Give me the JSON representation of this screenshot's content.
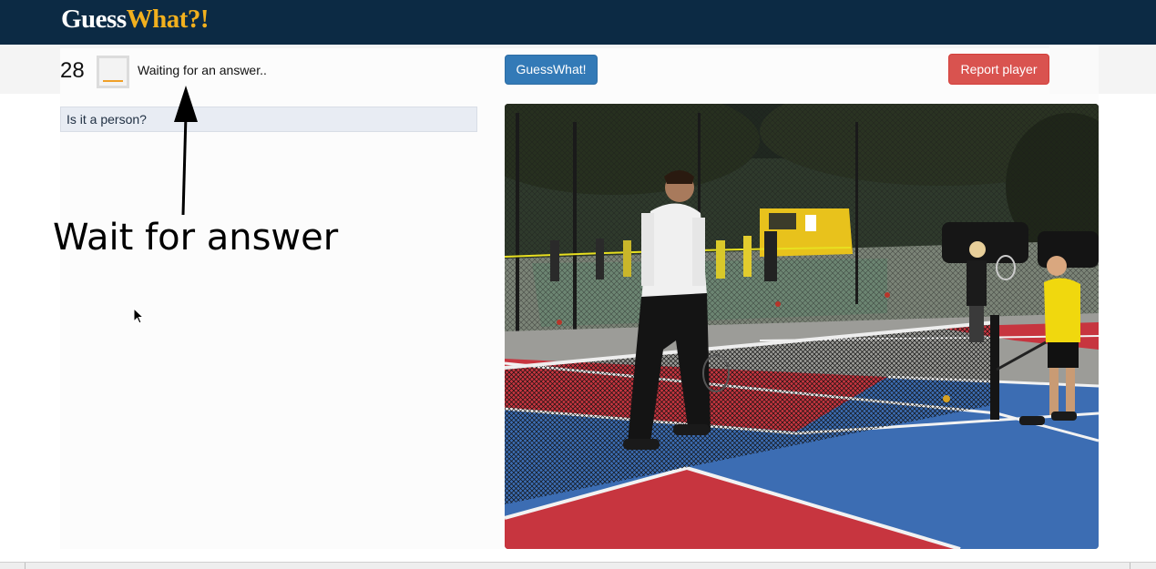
{
  "app": {
    "brand_part1": "Guess",
    "brand_part2": "What?!",
    "brand_color_primary": "#ffffff",
    "brand_color_accent": "#f2b01e",
    "navbar_color": "#0c2a44"
  },
  "game": {
    "counter": "28",
    "status_text": "Waiting for an answer..",
    "guess_button_label": "GuessWhat!",
    "report_button_label": "Report player",
    "guess_button_color": "#337ab7",
    "report_button_color": "#d9534f"
  },
  "dialogue": {
    "questions": [
      {
        "text": "Is it a person?"
      }
    ]
  },
  "annotation": {
    "label": "Wait for answer"
  },
  "image": {
    "subject": "tennis-court-scene"
  }
}
